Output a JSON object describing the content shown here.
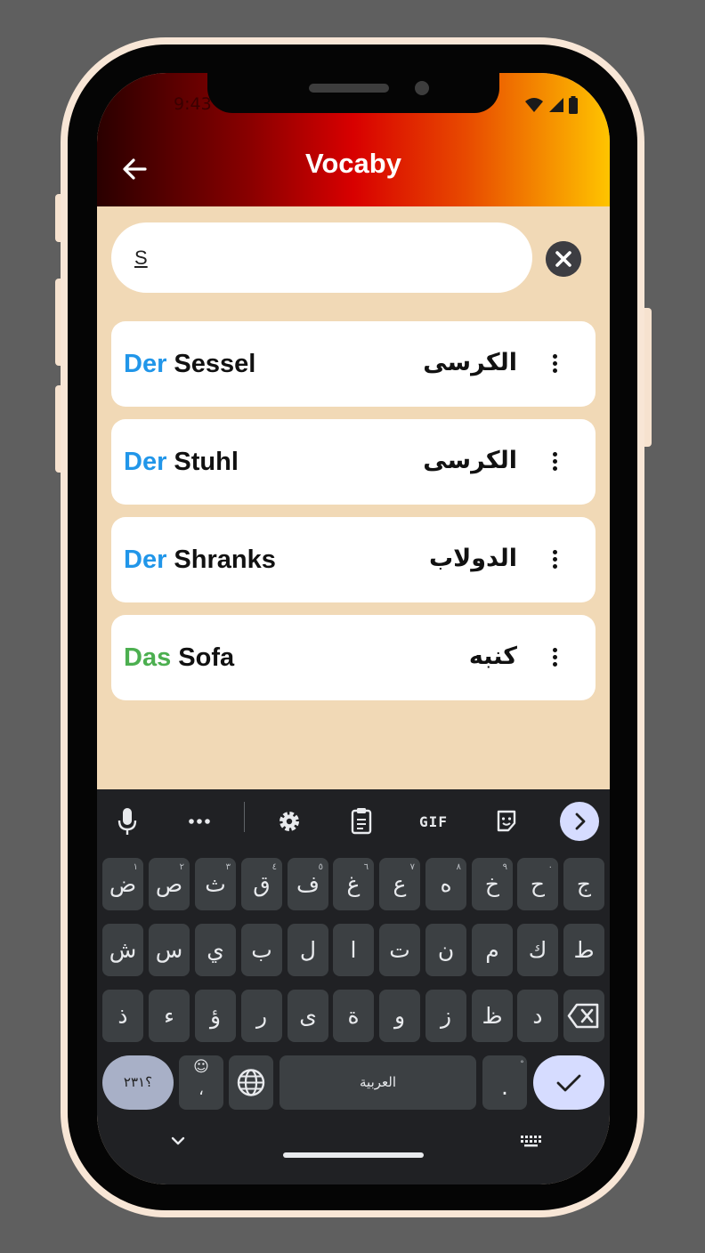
{
  "status_bar": {
    "time": "9:43"
  },
  "app_bar": {
    "title": "Vocaby",
    "back_icon": "arrow-left-icon"
  },
  "search": {
    "value": "S",
    "clear_icon": "close-circle-icon"
  },
  "words": [
    {
      "article": "Der",
      "noun": "Sessel",
      "translation": "الكرسى",
      "article_color": "#2196e9"
    },
    {
      "article": "Der",
      "noun": "Stuhl",
      "translation": "الكرسى",
      "article_color": "#2196e9"
    },
    {
      "article": "Der",
      "noun": "Shranks",
      "translation": "الدولاب",
      "article_color": "#2196e9"
    },
    {
      "article": "Das",
      "noun": "Sofa",
      "translation": "كنبه",
      "article_color": "#4caf50"
    }
  ],
  "keyboard": {
    "toolbar": [
      "microphone-icon",
      "more-icon",
      "settings-icon",
      "clipboard-icon",
      "gif-label",
      "sticker-icon",
      "expand-arrow-icon"
    ],
    "gif_label": "GIF",
    "row1": [
      {
        "key": "ض",
        "hint": "١"
      },
      {
        "key": "ص",
        "hint": "٢"
      },
      {
        "key": "ث",
        "hint": "٣"
      },
      {
        "key": "ق",
        "hint": "٤"
      },
      {
        "key": "ف",
        "hint": "٥"
      },
      {
        "key": "غ",
        "hint": "٦"
      },
      {
        "key": "ع",
        "hint": "٧"
      },
      {
        "key": "ه",
        "hint": "٨"
      },
      {
        "key": "خ",
        "hint": "٩"
      },
      {
        "key": "ح",
        "hint": "٠"
      },
      {
        "key": "ج",
        "hint": ""
      }
    ],
    "row2": [
      "ش",
      "س",
      "ي",
      "ب",
      "ل",
      "ا",
      "ت",
      "ن",
      "م",
      "ك",
      "ط"
    ],
    "row3": [
      "ذ",
      "ء",
      "ؤ",
      "ر",
      "ى",
      "ة",
      "و",
      "ز",
      "ظ",
      "د"
    ],
    "numbers_key": "؟٢٣١",
    "emoji_comma_key": "،",
    "space_label": "العربية",
    "period_key": ".",
    "period_hint": "ْ",
    "accent_color": "#d6dcff"
  },
  "colors": {
    "background": "#f1d9b6",
    "article_der": "#2196e9",
    "article_das": "#4caf50"
  }
}
